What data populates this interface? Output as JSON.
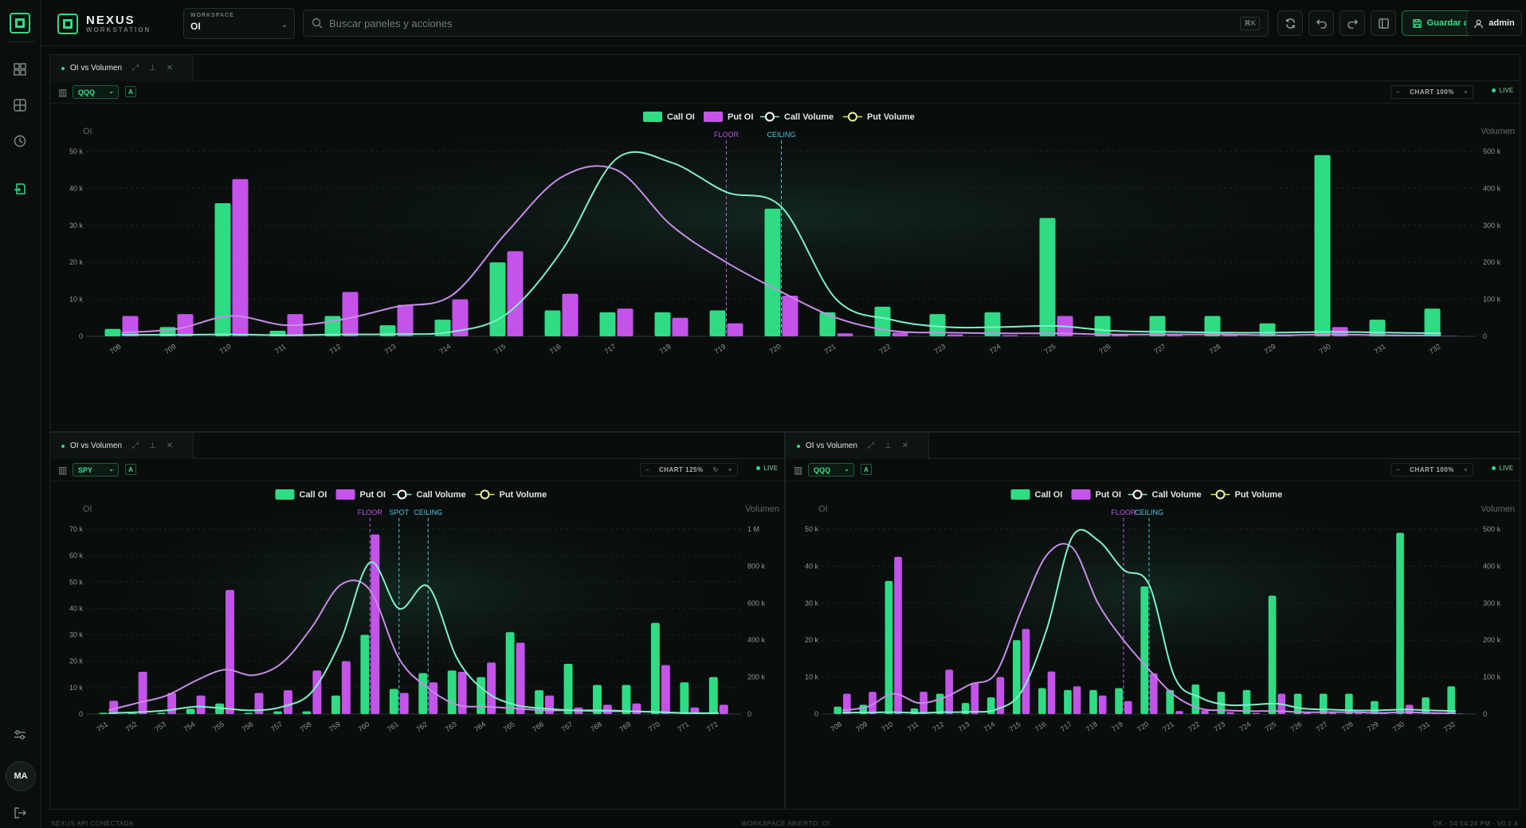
{
  "brand": {
    "name": "NEXUS",
    "sub": "WORKSTATION"
  },
  "workspace": {
    "label": "WORKSPACE",
    "value": "OI"
  },
  "search": {
    "placeholder": "Buscar paneles y acciones",
    "shortcut": "⌘K"
  },
  "toolbar": {
    "save_label": "Guardar actual",
    "user": "admin"
  },
  "rail": {
    "avatar": "MA"
  },
  "status": {
    "left": "NEXUS API CONECTADA",
    "center": "WORKSPACE ABIERTO: OI",
    "right": "OK · 04:54:24 PM · V0.1.4"
  },
  "colors": {
    "call": "#2fdc84",
    "put": "#c453ea",
    "accent": "#34e58a",
    "call_vol_line": "#7ef0c6",
    "put_vol_line": "#c88be8"
  },
  "legend": [
    "Call OI",
    "Put OI",
    "Call Volume",
    "Put Volume"
  ],
  "panels": [
    {
      "tab_title": "OI vs Volumen",
      "symbol": "QQQ",
      "mode_btn": "A",
      "zoom": "CHART 100%",
      "live": "LIVE",
      "chart_data": {
        "type": "bar",
        "left_axis_title": "OI",
        "right_axis_title": "Volumen",
        "y_left": {
          "ticks": [
            0,
            10,
            20,
            30,
            40,
            50
          ],
          "tick_labels": [
            "0",
            "10 k",
            "20 k",
            "30 k",
            "40 k",
            "50 k"
          ],
          "max": 50
        },
        "y_right": {
          "tick_labels": [
            "0",
            "100 k",
            "200 k",
            "300 k",
            "400 k",
            "500 k"
          ],
          "max": 500
        },
        "categories": [
          "708",
          "709",
          "710",
          "711",
          "712",
          "713",
          "714",
          "715",
          "716",
          "717",
          "718",
          "719",
          "720",
          "721",
          "722",
          "723",
          "724",
          "725",
          "726",
          "727",
          "728",
          "729",
          "730",
          "731",
          "732"
        ],
        "series": [
          {
            "name": "Call OI",
            "values": [
              2,
              2.5,
              36,
              1.5,
              5.5,
              3,
              4.5,
              20,
              7,
              6.5,
              6.5,
              7,
              34.5,
              6.5,
              8,
              6,
              6.5,
              32,
              5.5,
              5.5,
              5.5,
              3.5,
              49,
              4.5,
              7.5
            ]
          },
          {
            "name": "Put OI",
            "values": [
              5.5,
              6,
              42.5,
              6,
              12,
              8.5,
              10,
              23,
              11.5,
              7.5,
              5,
              3.5,
              11,
              0.8,
              1,
              0.5,
              0.3,
              5.5,
              0.5,
              0.3,
              0.3,
              0.2,
              2.5,
              0.2,
              0.1
            ]
          },
          {
            "name": "Call Volume",
            "values": [
              4,
              4,
              5,
              3,
              5,
              6,
              12,
              60,
              230,
              480,
              470,
              390,
              350,
              100,
              45,
              25,
              25,
              28,
              15,
              12,
              10,
              10,
              12,
              10,
              8
            ]
          },
          {
            "name": "Put Volume",
            "values": [
              10,
              20,
              55,
              30,
              45,
              80,
              110,
              280,
              430,
              450,
              300,
              200,
              120,
              50,
              15,
              10,
              8,
              8,
              5,
              5,
              5,
              3,
              5,
              3,
              2
            ]
          }
        ],
        "markers": [
          {
            "label": "FLOOR",
            "at": 719,
            "color": "#c453ea"
          },
          {
            "label": "CEILING",
            "at": 720,
            "color": "#4fc7e0"
          }
        ]
      }
    },
    {
      "tab_title": "OI vs Volumen",
      "symbol": "SPY",
      "mode_btn": "A",
      "zoom": "CHART 125%",
      "live": "LIVE",
      "chart_data": {
        "type": "bar",
        "left_axis_title": "OI",
        "right_axis_title": "Volumen",
        "y_left": {
          "ticks": [
            0,
            10,
            20,
            30,
            40,
            50,
            60,
            70
          ],
          "tick_labels": [
            "0",
            "10 k",
            "20 k",
            "30 k",
            "40 k",
            "50 k",
            "60 k",
            "70 k"
          ],
          "max": 70
        },
        "y_right": {
          "tick_labels": [
            "0",
            "200 k",
            "400 k",
            "600 k",
            "800 k",
            "1 M"
          ],
          "max": 1000
        },
        "categories": [
          "751",
          "752",
          "753",
          "754",
          "755",
          "756",
          "757",
          "758",
          "759",
          "760",
          "761",
          "762",
          "763",
          "764",
          "765",
          "766",
          "767",
          "768",
          "769",
          "770",
          "771",
          "772"
        ],
        "series": [
          {
            "name": "Call OI",
            "values": [
              0.5,
              0.3,
              0.5,
              2,
              4,
              0.5,
              1,
              1,
              7,
              30,
              9.5,
              15.5,
              16.5,
              14,
              31,
              9,
              19,
              11,
              11,
              34.5,
              12,
              14
            ]
          },
          {
            "name": "Put OI",
            "values": [
              5,
              16,
              8,
              7,
              47,
              8,
              9,
              16.5,
              20,
              68,
              8,
              12,
              16,
              19.5,
              27,
              7,
              2.5,
              3.5,
              4,
              18.5,
              2.5,
              3.5
            ]
          },
          {
            "name": "Call Volume",
            "values": [
              5,
              10,
              20,
              40,
              30,
              20,
              40,
              120,
              400,
              820,
              570,
              690,
              300,
              120,
              50,
              30,
              20,
              20,
              15,
              10,
              5,
              5
            ]
          },
          {
            "name": "Put Volume",
            "values": [
              20,
              60,
              100,
              180,
              240,
              210,
              280,
              470,
              700,
              670,
              300,
              140,
              50,
              40,
              30,
              20,
              20,
              15,
              15,
              10,
              5,
              5
            ]
          }
        ],
        "markers": [
          {
            "label": "FLOOR",
            "at": 760,
            "color": "#c453ea"
          },
          {
            "label": "SPOT",
            "at": 761,
            "color": "#4fc7e0"
          },
          {
            "label": "CEILING",
            "at": 762,
            "color": "#4fc7e0"
          }
        ]
      }
    },
    {
      "tab_title": "OI vs Volumen",
      "symbol": "QQQ",
      "mode_btn": "A",
      "zoom": "CHART 100%",
      "live": "LIVE",
      "chart_data": {
        "type": "bar",
        "left_axis_title": "OI",
        "right_axis_title": "Volumen",
        "y_left": {
          "ticks": [
            0,
            10,
            20,
            30,
            40,
            50
          ],
          "tick_labels": [
            "0",
            "10 k",
            "20 k",
            "30 k",
            "40 k",
            "50 k"
          ],
          "max": 50
        },
        "y_right": {
          "tick_labels": [
            "0",
            "100 k",
            "200 k",
            "300 k",
            "400 k",
            "500 k"
          ],
          "max": 500
        },
        "categories": [
          "708",
          "709",
          "710",
          "711",
          "712",
          "713",
          "714",
          "715",
          "716",
          "717",
          "718",
          "719",
          "720",
          "721",
          "722",
          "723",
          "724",
          "725",
          "726",
          "727",
          "728",
          "729",
          "730",
          "731",
          "732"
        ],
        "series": [
          {
            "name": "Call OI",
            "values": [
              2,
              2.5,
              36,
              1.5,
              5.5,
              3,
              4.5,
              20,
              7,
              6.5,
              6.5,
              7,
              34.5,
              6.5,
              8,
              6,
              6.5,
              32,
              5.5,
              5.5,
              5.5,
              3.5,
              49,
              4.5,
              7.5
            ]
          },
          {
            "name": "Put OI",
            "values": [
              5.5,
              6,
              42.5,
              6,
              12,
              8.5,
              10,
              23,
              11.5,
              7.5,
              5,
              3.5,
              11,
              0.8,
              1,
              0.5,
              0.3,
              5.5,
              0.5,
              0.3,
              0.3,
              0.2,
              2.5,
              0.2,
              0.1
            ]
          },
          {
            "name": "Call Volume",
            "values": [
              4,
              4,
              5,
              3,
              5,
              6,
              12,
              60,
              230,
              480,
              470,
              390,
              350,
              100,
              45,
              25,
              25,
              28,
              15,
              12,
              10,
              10,
              12,
              10,
              8
            ]
          },
          {
            "name": "Put Volume",
            "values": [
              10,
              20,
              55,
              30,
              45,
              80,
              110,
              280,
              430,
              450,
              300,
              200,
              120,
              50,
              15,
              10,
              8,
              8,
              5,
              5,
              5,
              3,
              5,
              3,
              2
            ]
          }
        ],
        "markers": [
          {
            "label": "FLOOR",
            "at": 719,
            "color": "#c453ea"
          },
          {
            "label": "CEILING",
            "at": 720,
            "color": "#4fc7e0"
          }
        ]
      }
    }
  ]
}
